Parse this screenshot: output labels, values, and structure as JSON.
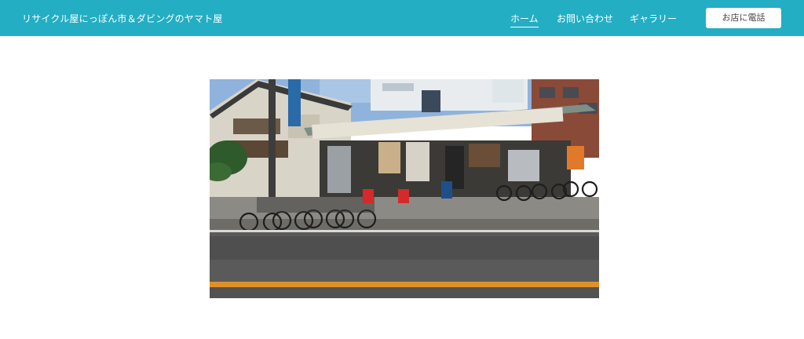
{
  "header": {
    "site_title": "リサイクル屋にっぽん市＆ダビングのヤマト屋",
    "nav": [
      {
        "label": "ホーム",
        "active": true
      },
      {
        "label": "お問い合わせ",
        "active": false
      },
      {
        "label": "ギャラリー",
        "active": false
      }
    ],
    "call_button_label": "お店に電話",
    "background_color": "#23aec4"
  },
  "main": {
    "photo": {
      "subject": "recycle shop storefront",
      "icon": "storefront-photo"
    }
  }
}
